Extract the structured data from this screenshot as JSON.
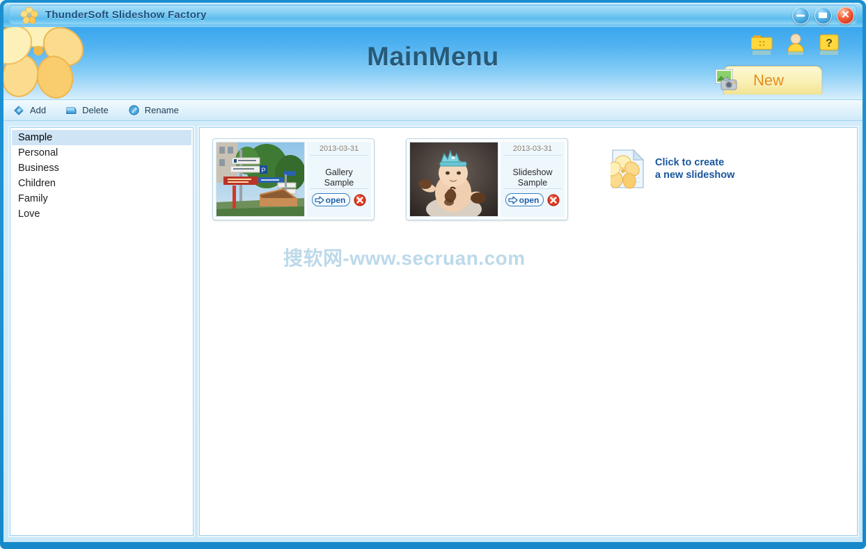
{
  "window": {
    "title": "ThunderSoft Slideshow Factory",
    "logo_icon": "flower-logo-icon",
    "controls": [
      {
        "name": "minimize-button",
        "icon": "minimize-icon",
        "label": ""
      },
      {
        "name": "restore-button",
        "icon": "restore-icon",
        "label": ""
      },
      {
        "name": "close-button",
        "icon": "close-icon",
        "label": "✕"
      }
    ]
  },
  "header": {
    "title": "MainMenu",
    "banner_flower_icon": "flower-logo-icon",
    "icons": [
      {
        "name": "options-folder-icon",
        "label": "options"
      },
      {
        "name": "user-account-icon",
        "label": "account"
      },
      {
        "name": "help-icon",
        "label": "?"
      }
    ],
    "new_tab": {
      "label": "New",
      "icon": "photo-camera-icon"
    }
  },
  "toolbar": {
    "items": [
      {
        "label": "Add",
        "icon": "add-icon"
      },
      {
        "label": "Delete",
        "icon": "delete-icon"
      },
      {
        "label": "Rename",
        "icon": "rename-icon"
      }
    ]
  },
  "sidebar": {
    "selected": "Sample",
    "items": [
      {
        "label": "Sample"
      },
      {
        "label": "Personal"
      },
      {
        "label": "Business"
      },
      {
        "label": "Children"
      },
      {
        "label": "Family"
      },
      {
        "label": "Love"
      }
    ]
  },
  "projects": [
    {
      "date": "2013-03-31",
      "name": "Gallery\nSample",
      "name_line1": "Gallery",
      "name_line2": "Sample",
      "open_label": "open",
      "thumbnail": "street-signpost-photo"
    },
    {
      "date": "2013-03-31",
      "name": "Slideshow\nSample",
      "name_line1": "Slideshow",
      "name_line2": "Sample",
      "open_label": "open",
      "thumbnail": "baby-with-crown-photo"
    }
  ],
  "create_new": {
    "line1": "Click to create",
    "line2": "a new slideshow",
    "icon": "new-document-flower-icon"
  },
  "watermark": {
    "text": "搜软网-www.secruan.com"
  },
  "colors": {
    "frame_blue": "#1f93d4",
    "header_blue": "#3aa6ee",
    "title_text": "#1b4f7e",
    "main_title": "#265a78",
    "accent_orange": "#e78a18",
    "link_blue": "#18559c",
    "selection": "#cfe4f5",
    "watermark": "#bcd9ea"
  }
}
